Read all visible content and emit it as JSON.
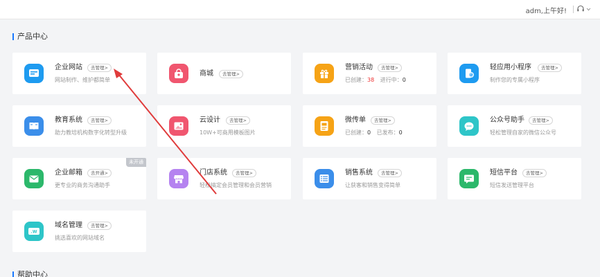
{
  "header": {
    "greeting": "adm,上午好!"
  },
  "sections": {
    "product_center": "产品中心",
    "help_center": "帮助中心"
  },
  "cards": [
    {
      "title": "企业网站",
      "button": "去管理>",
      "desc": "网站制作、维护都简单",
      "color": "#1e9bf0",
      "icon": "website-icon"
    },
    {
      "title": "商城",
      "button": "去管理>",
      "desc": "",
      "color": "#f0566f",
      "icon": "shopping-bag-icon"
    },
    {
      "title": "营销活动",
      "button": "去管理>",
      "desc_created_label": "已创建：",
      "desc_created_value": "38",
      "desc_ongoing_label": "进行中：",
      "desc_ongoing_value": "0",
      "color": "#f6a316",
      "icon": "gift-icon"
    },
    {
      "title": "轻应用小程序",
      "button": "去管理>",
      "desc": "制作您的专属小程序",
      "color": "#1e9bf0",
      "icon": "mini-program-icon"
    },
    {
      "title": "教育系统",
      "button": "去管理>",
      "desc": "助力教培机构数字化转型升级",
      "color": "#3b8eea",
      "icon": "book-icon"
    },
    {
      "title": "云设计",
      "button": "去管理>",
      "desc": "10W+可商用模板图片",
      "color": "#f0566f",
      "icon": "image-icon"
    },
    {
      "title": "微传单",
      "button": "去管理>",
      "desc_created_label": "已创建：",
      "desc_created_value": "0",
      "desc_ongoing_label": "已发布：",
      "desc_ongoing_value": "0",
      "color": "#f6a316",
      "icon": "flyer-icon"
    },
    {
      "title": "公众号助手",
      "button": "去管理>",
      "desc": "轻松管理自家的微信公众号",
      "color": "#2ec5c8",
      "icon": "wechat-icon"
    },
    {
      "title": "企业邮箱",
      "button": "去开通>",
      "desc": "更专业的商务沟通助手",
      "color": "#2cb86b",
      "icon": "mail-icon",
      "tag": "未开通"
    },
    {
      "title": "门店系统",
      "button": "去管理>",
      "desc": "轻松搞定会员管理和会员营销",
      "color": "#b583f0",
      "icon": "store-icon"
    },
    {
      "title": "销售系统",
      "button": "去管理>",
      "desc": "让获客和销售变得简单",
      "color": "#3b8eea",
      "icon": "list-icon"
    },
    {
      "title": "短信平台",
      "button": "去管理>",
      "desc": "短信发送管理平台",
      "color": "#2cb86b",
      "icon": "sms-icon"
    },
    {
      "title": "域名管理",
      "button": "去管理>",
      "desc": "挑选喜欢的网站域名",
      "color": "#2ec5c8",
      "icon": "domain-icon"
    }
  ],
  "annotation": {
    "type": "arrow",
    "color": "#e03c3c",
    "points_to": "企业网站"
  }
}
